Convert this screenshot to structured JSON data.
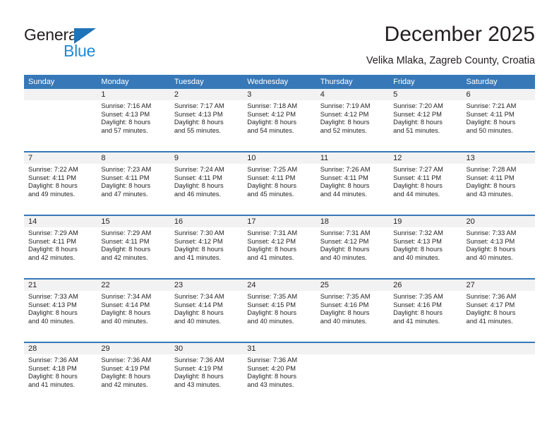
{
  "brand": {
    "name_part1": "General",
    "name_part2": "Blue",
    "triangle_color": "#1f73b7",
    "blue_color": "#1f8ad6"
  },
  "header": {
    "title": "December 2025",
    "subtitle": "Velika Mlaka, Zagreb County, Croatia"
  },
  "theme": {
    "header_blue": "#3778b8",
    "day_band_gray": "#f2f2f2",
    "text_color": "#231f20"
  },
  "weekdays": [
    "Sunday",
    "Monday",
    "Tuesday",
    "Wednesday",
    "Thursday",
    "Friday",
    "Saturday"
  ],
  "weeks": [
    [
      {
        "day": "",
        "sunrise": "",
        "sunset": "",
        "daylight_line1": "",
        "daylight_line2": ""
      },
      {
        "day": "1",
        "sunrise": "Sunrise: 7:16 AM",
        "sunset": "Sunset: 4:13 PM",
        "daylight_line1": "Daylight: 8 hours",
        "daylight_line2": "and 57 minutes."
      },
      {
        "day": "2",
        "sunrise": "Sunrise: 7:17 AM",
        "sunset": "Sunset: 4:13 PM",
        "daylight_line1": "Daylight: 8 hours",
        "daylight_line2": "and 55 minutes."
      },
      {
        "day": "3",
        "sunrise": "Sunrise: 7:18 AM",
        "sunset": "Sunset: 4:12 PM",
        "daylight_line1": "Daylight: 8 hours",
        "daylight_line2": "and 54 minutes."
      },
      {
        "day": "4",
        "sunrise": "Sunrise: 7:19 AM",
        "sunset": "Sunset: 4:12 PM",
        "daylight_line1": "Daylight: 8 hours",
        "daylight_line2": "and 52 minutes."
      },
      {
        "day": "5",
        "sunrise": "Sunrise: 7:20 AM",
        "sunset": "Sunset: 4:12 PM",
        "daylight_line1": "Daylight: 8 hours",
        "daylight_line2": "and 51 minutes."
      },
      {
        "day": "6",
        "sunrise": "Sunrise: 7:21 AM",
        "sunset": "Sunset: 4:11 PM",
        "daylight_line1": "Daylight: 8 hours",
        "daylight_line2": "and 50 minutes."
      }
    ],
    [
      {
        "day": "7",
        "sunrise": "Sunrise: 7:22 AM",
        "sunset": "Sunset: 4:11 PM",
        "daylight_line1": "Daylight: 8 hours",
        "daylight_line2": "and 49 minutes."
      },
      {
        "day": "8",
        "sunrise": "Sunrise: 7:23 AM",
        "sunset": "Sunset: 4:11 PM",
        "daylight_line1": "Daylight: 8 hours",
        "daylight_line2": "and 47 minutes."
      },
      {
        "day": "9",
        "sunrise": "Sunrise: 7:24 AM",
        "sunset": "Sunset: 4:11 PM",
        "daylight_line1": "Daylight: 8 hours",
        "daylight_line2": "and 46 minutes."
      },
      {
        "day": "10",
        "sunrise": "Sunrise: 7:25 AM",
        "sunset": "Sunset: 4:11 PM",
        "daylight_line1": "Daylight: 8 hours",
        "daylight_line2": "and 45 minutes."
      },
      {
        "day": "11",
        "sunrise": "Sunrise: 7:26 AM",
        "sunset": "Sunset: 4:11 PM",
        "daylight_line1": "Daylight: 8 hours",
        "daylight_line2": "and 44 minutes."
      },
      {
        "day": "12",
        "sunrise": "Sunrise: 7:27 AM",
        "sunset": "Sunset: 4:11 PM",
        "daylight_line1": "Daylight: 8 hours",
        "daylight_line2": "and 44 minutes."
      },
      {
        "day": "13",
        "sunrise": "Sunrise: 7:28 AM",
        "sunset": "Sunset: 4:11 PM",
        "daylight_line1": "Daylight: 8 hours",
        "daylight_line2": "and 43 minutes."
      }
    ],
    [
      {
        "day": "14",
        "sunrise": "Sunrise: 7:29 AM",
        "sunset": "Sunset: 4:11 PM",
        "daylight_line1": "Daylight: 8 hours",
        "daylight_line2": "and 42 minutes."
      },
      {
        "day": "15",
        "sunrise": "Sunrise: 7:29 AM",
        "sunset": "Sunset: 4:11 PM",
        "daylight_line1": "Daylight: 8 hours",
        "daylight_line2": "and 42 minutes."
      },
      {
        "day": "16",
        "sunrise": "Sunrise: 7:30 AM",
        "sunset": "Sunset: 4:12 PM",
        "daylight_line1": "Daylight: 8 hours",
        "daylight_line2": "and 41 minutes."
      },
      {
        "day": "17",
        "sunrise": "Sunrise: 7:31 AM",
        "sunset": "Sunset: 4:12 PM",
        "daylight_line1": "Daylight: 8 hours",
        "daylight_line2": "and 41 minutes."
      },
      {
        "day": "18",
        "sunrise": "Sunrise: 7:31 AM",
        "sunset": "Sunset: 4:12 PM",
        "daylight_line1": "Daylight: 8 hours",
        "daylight_line2": "and 40 minutes."
      },
      {
        "day": "19",
        "sunrise": "Sunrise: 7:32 AM",
        "sunset": "Sunset: 4:13 PM",
        "daylight_line1": "Daylight: 8 hours",
        "daylight_line2": "and 40 minutes."
      },
      {
        "day": "20",
        "sunrise": "Sunrise: 7:33 AM",
        "sunset": "Sunset: 4:13 PM",
        "daylight_line1": "Daylight: 8 hours",
        "daylight_line2": "and 40 minutes."
      }
    ],
    [
      {
        "day": "21",
        "sunrise": "Sunrise: 7:33 AM",
        "sunset": "Sunset: 4:13 PM",
        "daylight_line1": "Daylight: 8 hours",
        "daylight_line2": "and 40 minutes."
      },
      {
        "day": "22",
        "sunrise": "Sunrise: 7:34 AM",
        "sunset": "Sunset: 4:14 PM",
        "daylight_line1": "Daylight: 8 hours",
        "daylight_line2": "and 40 minutes."
      },
      {
        "day": "23",
        "sunrise": "Sunrise: 7:34 AM",
        "sunset": "Sunset: 4:14 PM",
        "daylight_line1": "Daylight: 8 hours",
        "daylight_line2": "and 40 minutes."
      },
      {
        "day": "24",
        "sunrise": "Sunrise: 7:35 AM",
        "sunset": "Sunset: 4:15 PM",
        "daylight_line1": "Daylight: 8 hours",
        "daylight_line2": "and 40 minutes."
      },
      {
        "day": "25",
        "sunrise": "Sunrise: 7:35 AM",
        "sunset": "Sunset: 4:16 PM",
        "daylight_line1": "Daylight: 8 hours",
        "daylight_line2": "and 40 minutes."
      },
      {
        "day": "26",
        "sunrise": "Sunrise: 7:35 AM",
        "sunset": "Sunset: 4:16 PM",
        "daylight_line1": "Daylight: 8 hours",
        "daylight_line2": "and 41 minutes."
      },
      {
        "day": "27",
        "sunrise": "Sunrise: 7:36 AM",
        "sunset": "Sunset: 4:17 PM",
        "daylight_line1": "Daylight: 8 hours",
        "daylight_line2": "and 41 minutes."
      }
    ],
    [
      {
        "day": "28",
        "sunrise": "Sunrise: 7:36 AM",
        "sunset": "Sunset: 4:18 PM",
        "daylight_line1": "Daylight: 8 hours",
        "daylight_line2": "and 41 minutes."
      },
      {
        "day": "29",
        "sunrise": "Sunrise: 7:36 AM",
        "sunset": "Sunset: 4:19 PM",
        "daylight_line1": "Daylight: 8 hours",
        "daylight_line2": "and 42 minutes."
      },
      {
        "day": "30",
        "sunrise": "Sunrise: 7:36 AM",
        "sunset": "Sunset: 4:19 PM",
        "daylight_line1": "Daylight: 8 hours",
        "daylight_line2": "and 43 minutes."
      },
      {
        "day": "31",
        "sunrise": "Sunrise: 7:36 AM",
        "sunset": "Sunset: 4:20 PM",
        "daylight_line1": "Daylight: 8 hours",
        "daylight_line2": "and 43 minutes."
      },
      {
        "day": "",
        "sunrise": "",
        "sunset": "",
        "daylight_line1": "",
        "daylight_line2": ""
      },
      {
        "day": "",
        "sunrise": "",
        "sunset": "",
        "daylight_line1": "",
        "daylight_line2": ""
      },
      {
        "day": "",
        "sunrise": "",
        "sunset": "",
        "daylight_line1": "",
        "daylight_line2": ""
      }
    ]
  ]
}
